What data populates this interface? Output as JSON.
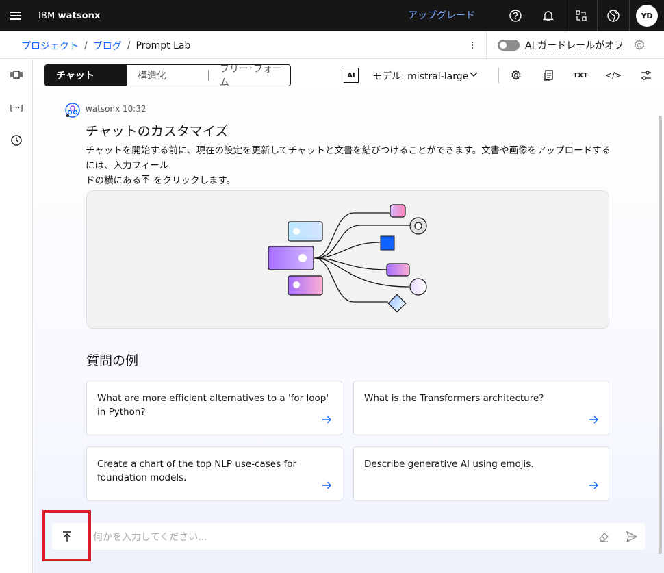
{
  "header": {
    "menu_icon": "hamburger-icon",
    "brand_prefix": "IBM ",
    "brand_name": "watsonx",
    "upgrade_label": "アップグレード",
    "user_initials": "YD",
    "icons": [
      "help-icon",
      "notification-icon",
      "switcher-icon",
      "globe-icon"
    ]
  },
  "breadcrumb": {
    "items": [
      "プロジェクト",
      "ブログ",
      "Prompt Lab"
    ],
    "separator": "/"
  },
  "guardrails": {
    "label": "AI ガードレールがオフ",
    "enabled": false
  },
  "rail": {
    "icons": [
      "compare-icon",
      "variables-icon",
      "history-icon"
    ],
    "variables_glyph": "[···]"
  },
  "toolbar": {
    "modes": [
      "チャット",
      "構造化",
      "フリー･フォーム"
    ],
    "active_mode": "チャット",
    "ai_badge": "AI",
    "model_label": "モデル: mistral-large",
    "txt_label": "TXT",
    "code_label": "</>"
  },
  "message": {
    "sender": "watsonx",
    "time": "10:32",
    "title": "チャットのカスタマイズ",
    "body_line1": "チャットを開始する前に、現在の設定を更新してチャットと文書を結びつけることができます。文書や画像をアップロードするには、入力フィール",
    "body_line2_a": "ドの横にある",
    "body_line2_b": "をクリックします。"
  },
  "examples": {
    "title": "質問の例",
    "items": [
      "What are more efficient alternatives to a 'for loop' in Python?",
      "What is the Transformers architecture?",
      "Create a chart of the top NLP use-cases for foundation models.",
      "Describe generative AI using emojis."
    ]
  },
  "input": {
    "placeholder": "何かを入力してください..."
  },
  "colors": {
    "header_bg": "#161616",
    "link": "#0f62fe",
    "upgrade": "#78a9ff",
    "highlight": "#da1e28"
  }
}
